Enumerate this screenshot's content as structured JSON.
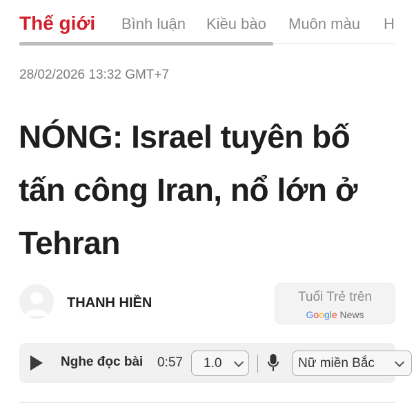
{
  "nav": {
    "items": [
      {
        "label": "Thế giới",
        "active": true
      },
      {
        "label": "Bình luận",
        "active": false
      },
      {
        "label": "Kiều bào",
        "active": false
      },
      {
        "label": "Muôn màu",
        "active": false
      },
      {
        "label": "H",
        "active": false
      }
    ],
    "accent_color": "#d0202c"
  },
  "article": {
    "timestamp": "28/02/2026 13:32 GMT+7",
    "headline": "NÓNG: Israel tuyên bố tấn công Iran, nổ lớn ở Tehran",
    "author": "THANH HIỀN"
  },
  "google_news": {
    "line1": "Tuổi Trẻ trên",
    "brand": "Google",
    "product": "News"
  },
  "audio_player": {
    "listen_label": "Nghe đọc bài",
    "duration": "0:57",
    "speed_value": "1.0",
    "voice_value": "Nữ miền Bắc"
  }
}
